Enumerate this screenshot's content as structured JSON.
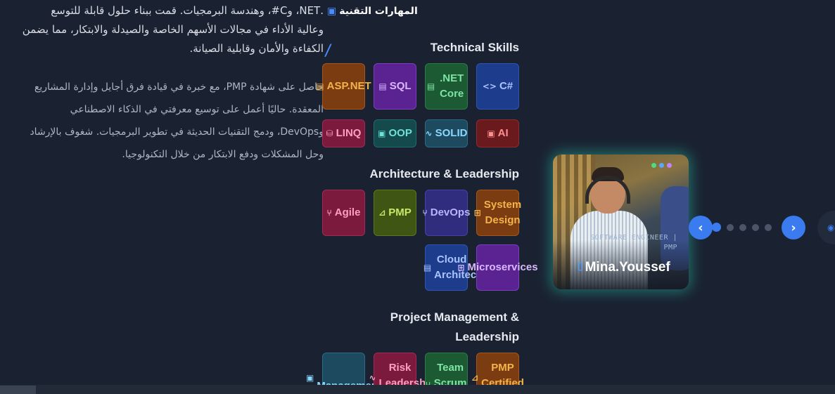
{
  "about": {
    "paragraph1": ".NET، وC#، وهندسة البرمجيات. قمت ببناء حلول قابلة للتوسع وعالية الأداء في مجالات الأسهم الخاصة والصيدلة والابتكار، مما يضمن الكفاءة والأمان وقابلية الصيانة.",
    "paragraph2": "حاصل على شهادة PMP، مع خبرة في قيادة فرق أجايل وإدارة المشاريع المعقدة. حاليًا أعمل على توسيع معرفتي في الذكاء الاصطناعي وDevOps، ودمج التقنيات الحديثة في تطوير البرمجيات. شغوف بالإرشاد وحل المشكلات ودفع الابتكار من خلال التكنولوجيا."
  },
  "skills": {
    "heading_ar": "المهارات التقنية",
    "technical_title": "Technical Skills",
    "technical": [
      {
        "label": "ASP.NET",
        "icon": "server-icon",
        "glyph": "▤"
      },
      {
        "label": "SQL",
        "icon": "server-icon",
        "glyph": "▤"
      },
      {
        "label": ".NET Core",
        "icon": "server-icon",
        "glyph": "▤"
      },
      {
        "label": "C#",
        "icon": "code-icon",
        "glyph": "<>"
      },
      {
        "label": "LINQ",
        "icon": "database-icon",
        "glyph": "⛁"
      },
      {
        "label": "OOP",
        "icon": "cpu-icon",
        "glyph": "▣"
      },
      {
        "label": "SOLID",
        "icon": "activity-icon",
        "glyph": "∿"
      },
      {
        "label": "AI",
        "icon": "cpu-icon",
        "glyph": "▣"
      }
    ],
    "architecture_title": "Architecture & Leadership",
    "architecture": [
      {
        "label": "Agile",
        "icon": "git-branch-icon",
        "glyph": "⑂"
      },
      {
        "label": "PMP",
        "icon": "chart-icon",
        "glyph": "⊿"
      },
      {
        "label": "DevOps",
        "icon": "git-branch-icon",
        "glyph": "⑂"
      },
      {
        "label": "System Design",
        "icon": "grid-icon",
        "glyph": "⊞"
      },
      {
        "label": "Cloud Architecture",
        "icon": "server-icon",
        "glyph": "▤"
      },
      {
        "label": "Microservices",
        "icon": "grid-icon",
        "glyph": "⊞"
      }
    ],
    "pm_title": "Project Management & Leadership",
    "pm": [
      {
        "label": "Management",
        "icon": "cpu-icon",
        "glyph": "▣"
      },
      {
        "label": "Risk Leadership",
        "icon": "activity-icon",
        "glyph": "∿"
      },
      {
        "label": "Team Scrum",
        "icon": "git-branch-icon",
        "glyph": "⑂"
      },
      {
        "label": "PMP Certified",
        "icon": "chart-icon",
        "glyph": "⊿"
      }
    ]
  },
  "profile": {
    "role_line1": "SOFTWARE ENGINEER |",
    "role_line2": "PMP",
    "name": "Mina.Youssef"
  },
  "carousel": {
    "prev": "‹",
    "next": "›",
    "active_index": 0,
    "count": 5
  },
  "colors": {
    "accent": "#3a7bf0",
    "background": "#1a2231"
  }
}
